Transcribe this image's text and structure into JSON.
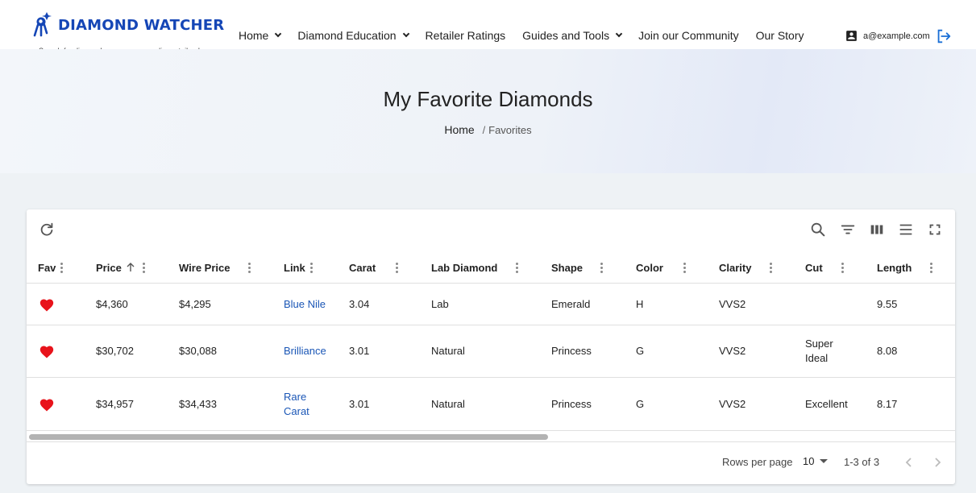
{
  "brand": {
    "name": "DIAMOND WATCHER",
    "tagline": "Search for diamonds across many online retailers!",
    "accent": "#1546b6"
  },
  "nav": {
    "items": [
      {
        "label": "Home",
        "dropdown": true
      },
      {
        "label": "Diamond Education",
        "dropdown": true
      },
      {
        "label": "Retailer Ratings",
        "dropdown": false
      },
      {
        "label": "Guides and Tools",
        "dropdown": true
      },
      {
        "label": "Join our Community",
        "dropdown": false
      },
      {
        "label": "Our Story",
        "dropdown": false
      }
    ]
  },
  "account": {
    "email": "a@example.com",
    "icon": "account-box-icon",
    "logout_icon": "logout-icon"
  },
  "hero": {
    "title": "My Favorite Diamonds",
    "breadcrumb_home": "Home",
    "breadcrumb_sep": "/",
    "breadcrumb_current": "Favorites"
  },
  "table": {
    "columns": [
      "Fav",
      "Price",
      "Wire Price",
      "Link",
      "Carat",
      "Lab Diamond",
      "Shape",
      "Color",
      "Clarity",
      "Cut",
      "Length"
    ],
    "sorted_column": "Price",
    "sort_direction": "ascending",
    "rows": [
      {
        "price": "$4,360",
        "wire_price": "$4,295",
        "link": "Blue Nile",
        "carat": "3.04",
        "lab": "Lab",
        "shape": "Emerald",
        "color": "H",
        "clarity": "VVS2",
        "cut": "",
        "length": "9.55"
      },
      {
        "price": "$30,702",
        "wire_price": "$30,088",
        "link": "Brilliance",
        "carat": "3.01",
        "lab": "Natural",
        "shape": "Princess",
        "color": "G",
        "clarity": "VVS2",
        "cut": "Super Ideal",
        "length": "8.08"
      },
      {
        "price": "$34,957",
        "wire_price": "$34,433",
        "link": "Rare Carat",
        "carat": "3.01",
        "lab": "Natural",
        "shape": "Princess",
        "color": "G",
        "clarity": "VVS2",
        "cut": "Excellent",
        "length": "8.17"
      }
    ],
    "fav_color": "#e8131b",
    "link_color": "#1a56b6"
  },
  "pagination": {
    "rows_per_page_label": "Rows per page",
    "rows_per_page": "10",
    "range": "1-3 of 3"
  }
}
